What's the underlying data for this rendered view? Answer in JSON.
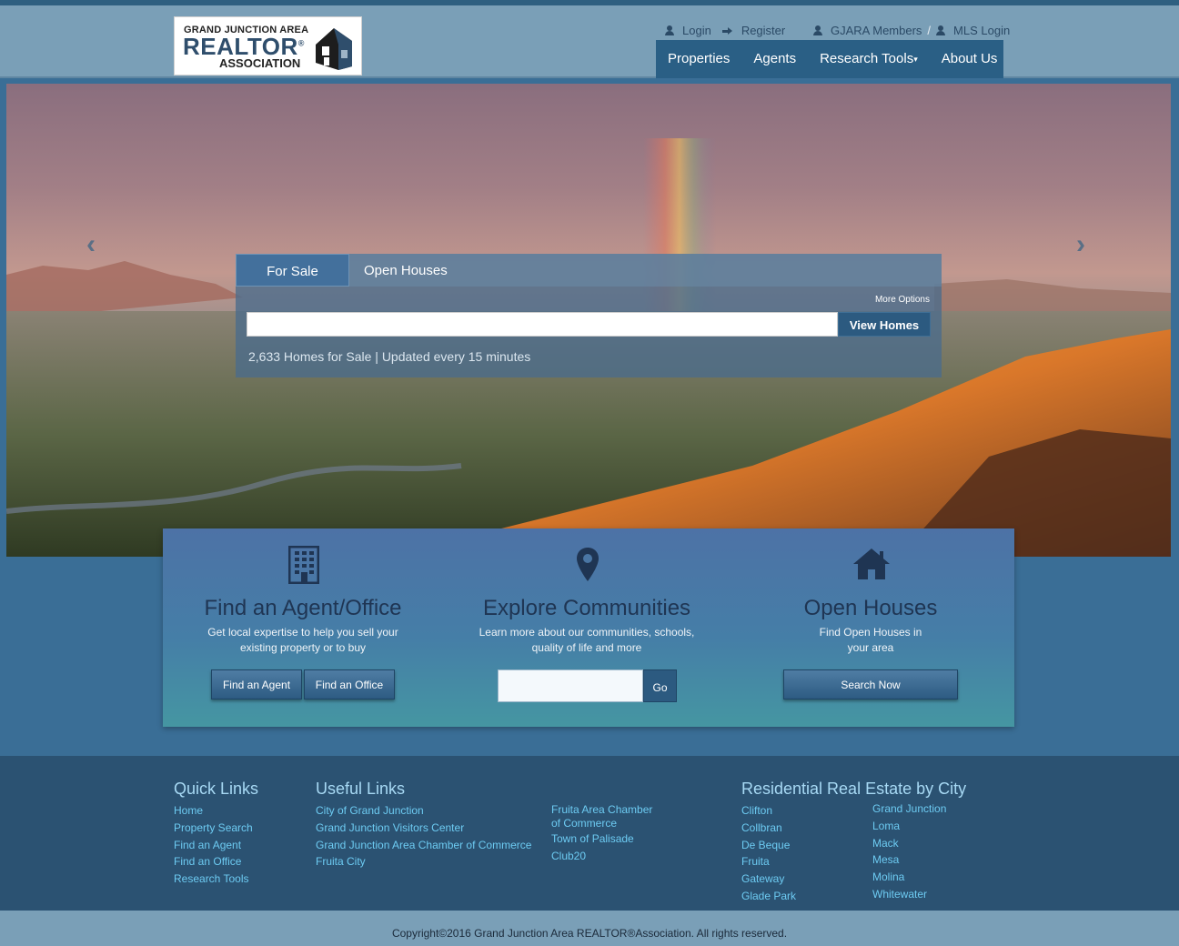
{
  "logo": {
    "line1": "GRAND JUNCTION AREA",
    "line2": "REALTOR",
    "registered": "®",
    "line3": "ASSOCIATION"
  },
  "top_links": {
    "login": "Login",
    "register": "Register",
    "members": "GJARA Members",
    "separator": "/",
    "mls_login": "MLS Login"
  },
  "nav": {
    "properties": "Properties",
    "agents": "Agents",
    "research_tools": "Research Tools",
    "about_us": "About Us"
  },
  "hero": {
    "prev_icon": "chevron-left-icon",
    "next_icon": "chevron-right-icon"
  },
  "search": {
    "tabs": [
      "For Sale",
      "Open Houses"
    ],
    "more_options": "More Options",
    "input_value": "",
    "view_button": "View Homes",
    "homes_count": "2,633 Homes for Sale | Updated every 15 minutes"
  },
  "features": {
    "agent": {
      "icon": "building-icon",
      "title": "Find an Agent/Office",
      "desc_line1": "Get local expertise to help you sell your",
      "desc_line2": "existing property or to buy",
      "btn_agent": "Find an Agent",
      "btn_office": "Find an Office"
    },
    "communities": {
      "icon": "map-marker-icon",
      "title": "Explore Communities",
      "desc_line1": "Learn more about our communities, schools,",
      "desc_line2": "quality of life and more",
      "input_value": "",
      "go": "Go"
    },
    "open_houses": {
      "icon": "home-icon",
      "title": "Open Houses",
      "desc_line1": "Find Open Houses in",
      "desc_line2": "your area",
      "btn": "Search Now"
    }
  },
  "footer": {
    "quick_links": {
      "title": "Quick Links",
      "items": [
        "Home",
        "Property Search",
        "Find an Agent",
        "Find an Office",
        "Research Tools"
      ]
    },
    "useful_links": {
      "title": "Useful Links",
      "col1": [
        "City of Grand Junction",
        "Grand Junction Visitors Center",
        "Grand Junction Area Chamber of Commerce",
        "Fruita City"
      ],
      "col2_first_line1": "Fruita Area Chamber",
      "col2_first_line2": "of Commerce",
      "col2": [
        "Town of Palisade",
        "Club20"
      ]
    },
    "residential": {
      "title": "Residential Real Estate by City",
      "col1": [
        "Clifton",
        "Collbran",
        "De Beque",
        "Fruita",
        "Gateway",
        "Glade Park"
      ],
      "col2": [
        "Grand Junction",
        "Loma",
        "Mack",
        "Mesa",
        "Molina",
        "Whitewater"
      ]
    }
  },
  "copyright": "Copyright©2016 Grand Junction Area REALTOR®Association. All rights reserved.",
  "colors": {
    "nav_bg": "#2a5f85",
    "header_bg": "#7a9fb7",
    "footer_bg": "#2b5272",
    "footer_link": "#6dcbf2"
  }
}
